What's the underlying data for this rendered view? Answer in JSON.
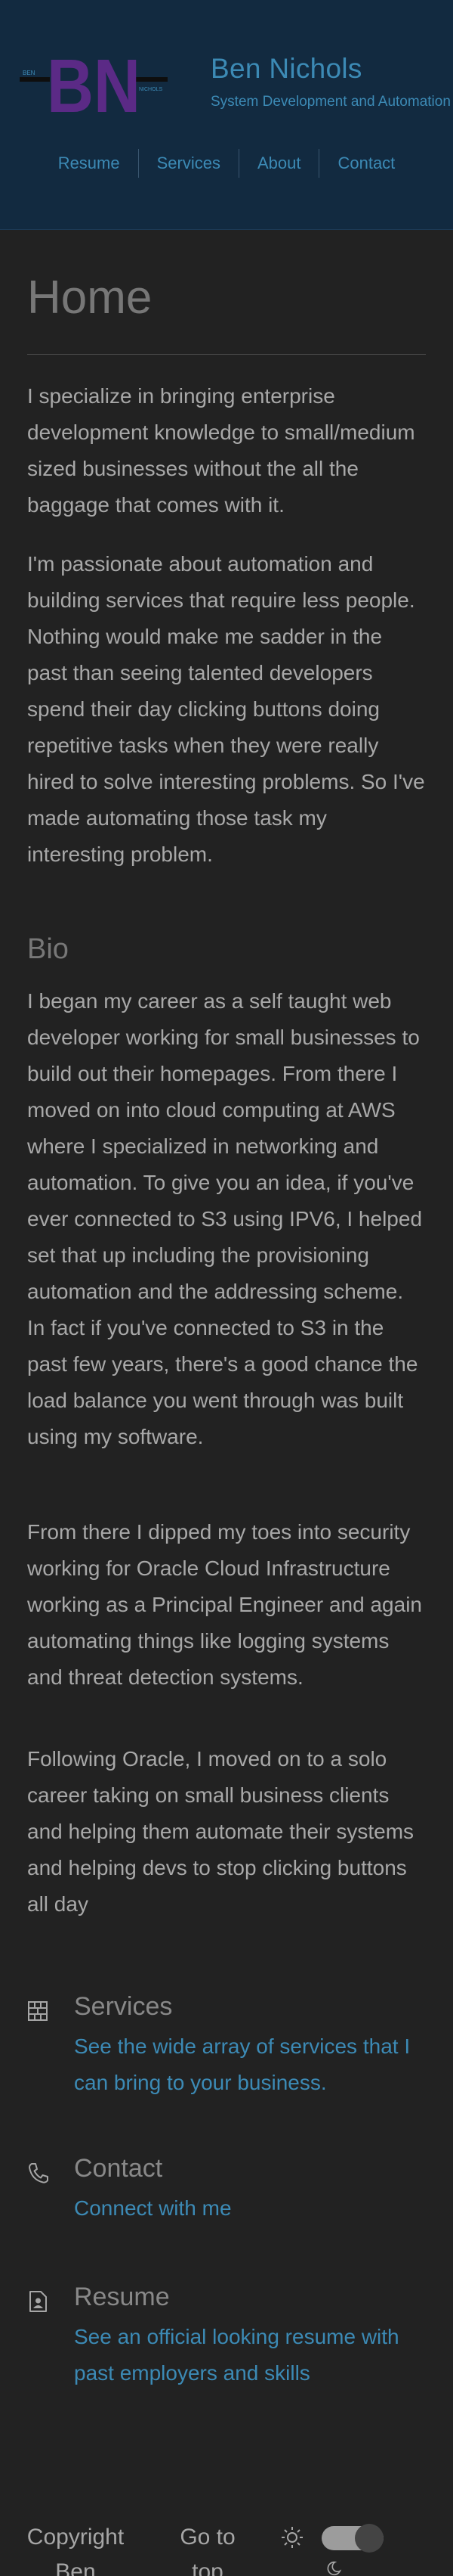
{
  "header": {
    "logo_text": "BN",
    "title": "Ben Nichols",
    "subtitle": "System Development and Automation"
  },
  "nav": {
    "items": [
      {
        "label": "Resume"
      },
      {
        "label": "Services"
      },
      {
        "label": "About"
      },
      {
        "label": "Contact"
      }
    ]
  },
  "main": {
    "title": "Home",
    "intro": [
      "I specialize in bringing enterprise development knowledge to small/medium sized businesses without the all the baggage that comes with it.",
      "I'm passionate about automation and building services that require less people. Nothing would make me sadder in the past than seeing talented developers spend their day clicking buttons doing repetitive tasks when they were really hired to solve interesting problems. So I've made automating those task my interesting problem."
    ],
    "bio_heading": "Bio",
    "bio": [
      "I began my career as a self taught web developer working for small businesses to build out their homepages. From there I moved on into cloud computing at AWS where I specialized in networking and automation. To give you an idea, if you've ever connected to S3 using IPV6, I helped set that up including the provisioning automation and the addressing scheme. In fact if you've connected to S3 in the past few years, there's a good chance the load balance you went through was built using my software.",
      "From there I dipped my toes into security working for Oracle Cloud Infrastructure working as a Principal Engineer and again automating things like logging systems and threat detection systems.",
      "Following Oracle, I moved on to a solo career taking on small business clients and helping them automate their systems and helping devs to stop clicking buttons all day"
    ]
  },
  "features": [
    {
      "icon": "services-icon",
      "heading": "Services",
      "link": "See the wide array of services that I can bring to your business."
    },
    {
      "icon": "phone-icon",
      "heading": "Contact",
      "link": "Connect with me"
    },
    {
      "icon": "resume-icon",
      "heading": "Resume",
      "link": "See an official looking resume with past employers and skills"
    }
  ],
  "footer": {
    "copyright": "Copyright Ben",
    "go_to_top": "Go to top",
    "theme_toggle_state": "on"
  },
  "colors": {
    "background": "#222222",
    "header_background": "#122a40",
    "accent": "#3c8ab5",
    "logo_purple": "#5b2a86"
  }
}
